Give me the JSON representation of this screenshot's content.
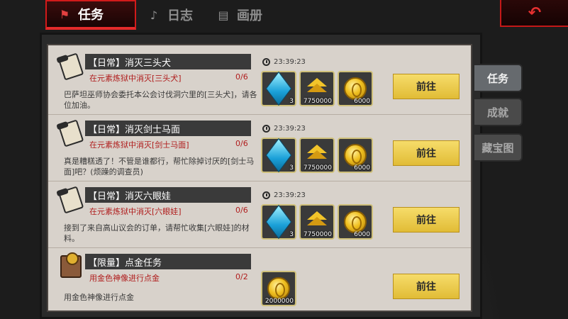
{
  "top_tabs": [
    {
      "label": "任务",
      "icon": "quest-flag-icon",
      "active": true
    },
    {
      "label": "日志",
      "icon": "bell-icon",
      "active": false
    },
    {
      "label": "画册",
      "icon": "album-icon",
      "active": false
    }
  ],
  "back_button": {
    "icon": "back-arrow-icon"
  },
  "side_tabs": [
    {
      "label": "任务",
      "active": true
    },
    {
      "label": "成就",
      "active": false
    },
    {
      "label": "藏宝图",
      "active": false
    }
  ],
  "quests": [
    {
      "title": "【日常】消灭三头犬",
      "subtitle": "在元素炼狱中消灭[三头犬]",
      "count": "0/6",
      "desc": "巴萨坦巫师协会委托本公会讨伐洞穴里的[三头犬]，请各位加油。",
      "timer": "23:39:23",
      "icon": "scroll-icon",
      "rewards": [
        {
          "icon": "blue-gem-icon",
          "qty": "3"
        },
        {
          "icon": "exp-chevron-icon",
          "qty": "7750000"
        },
        {
          "icon": "gold-coin-icon",
          "qty": "6000"
        }
      ],
      "button": "前往"
    },
    {
      "title": "【日常】消灭剑士马面",
      "subtitle": "在元素炼狱中消灭[剑士马面]",
      "count": "0/6",
      "desc": "真是糟糕透了！不管是谁都行，帮忙除掉讨厌的[剑士马面]吧？(烦躁的调查员)",
      "timer": "23:39:23",
      "icon": "scroll-icon",
      "rewards": [
        {
          "icon": "blue-gem-icon",
          "qty": "3"
        },
        {
          "icon": "exp-chevron-icon",
          "qty": "7750000"
        },
        {
          "icon": "gold-coin-icon",
          "qty": "6000"
        }
      ],
      "button": "前往"
    },
    {
      "title": "【日常】消灭六眼娃",
      "subtitle": "在元素炼狱中消灭[六眼娃]",
      "count": "0/6",
      "desc": "接到了来自高山议会的订单，请帮忙收集[六眼娃]的材料。",
      "timer": "23:39:23",
      "icon": "scroll-icon",
      "rewards": [
        {
          "icon": "blue-gem-icon",
          "qty": "3"
        },
        {
          "icon": "exp-chevron-icon",
          "qty": "7750000"
        },
        {
          "icon": "gold-coin-icon",
          "qty": "6000"
        }
      ],
      "button": "前往"
    },
    {
      "title": "【限量】点金任务",
      "subtitle": "用金色神像进行点金",
      "count": "0/2",
      "desc": "用金色神像进行点金",
      "icon": "gold-book-icon",
      "rewards": [
        {
          "icon": "gold-coin-icon",
          "qty": "2000000"
        }
      ],
      "button": "前往"
    }
  ]
}
